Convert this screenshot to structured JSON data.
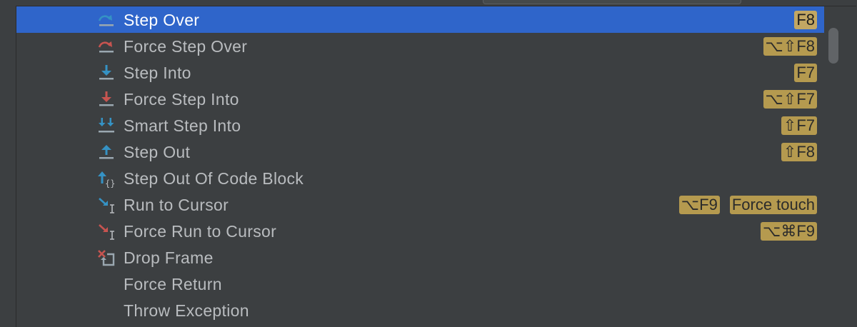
{
  "menu": {
    "items": [
      {
        "label": "Step Over",
        "icon": "step-over-icon",
        "shortcuts": [
          "F8"
        ],
        "selected": true
      },
      {
        "label": "Force Step Over",
        "icon": "force-step-over-icon",
        "shortcuts": [
          "⌥⇧F8"
        ]
      },
      {
        "label": "Step Into",
        "icon": "step-into-icon",
        "shortcuts": [
          "F7"
        ]
      },
      {
        "label": "Force Step Into",
        "icon": "force-step-into-icon",
        "shortcuts": [
          "⌥⇧F7"
        ]
      },
      {
        "label": "Smart Step Into",
        "icon": "smart-step-into-icon",
        "shortcuts": [
          "⇧F7"
        ]
      },
      {
        "label": "Step Out",
        "icon": "step-out-icon",
        "shortcuts": [
          "⇧F8"
        ]
      },
      {
        "label": "Step Out Of Code Block",
        "icon": "step-out-code-block-icon",
        "shortcuts": []
      },
      {
        "label": "Run to Cursor",
        "icon": "run-to-cursor-icon",
        "shortcuts": [
          "⌥F9",
          "Force touch"
        ]
      },
      {
        "label": "Force Run to Cursor",
        "icon": "force-run-to-cursor-icon",
        "shortcuts": [
          "⌥⌘F9"
        ]
      },
      {
        "label": "Drop Frame",
        "icon": "drop-frame-icon",
        "shortcuts": []
      },
      {
        "label": "Force Return",
        "icon": "",
        "shortcuts": []
      },
      {
        "label": "Throw Exception",
        "icon": "",
        "shortcuts": []
      }
    ]
  },
  "colors": {
    "background": "#3c3f41",
    "selection": "#2f65ca",
    "shortcut_badge": "#b59a4f",
    "icon_blue": "#3592c4",
    "icon_red": "#c75450"
  }
}
